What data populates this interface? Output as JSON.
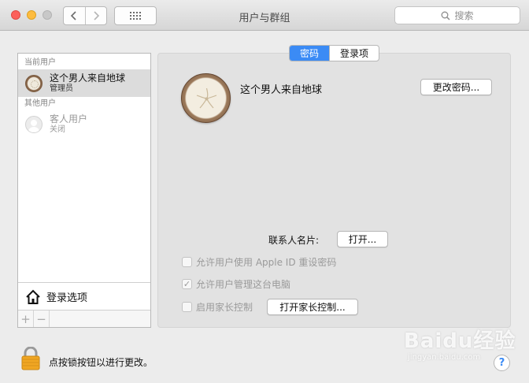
{
  "window": {
    "title": "用户与群组",
    "search_placeholder": "搜索"
  },
  "sidebar": {
    "current_users_header": "当前用户",
    "current_user": {
      "name": "这个男人来自地球",
      "role": "管理员"
    },
    "other_users_header": "其他用户",
    "guest_user": {
      "name": "客人用户",
      "status": "关闭"
    },
    "login_options_label": "登录选项",
    "add_label": "+",
    "remove_label": "−"
  },
  "tabs": [
    {
      "label": "密码",
      "active": true
    },
    {
      "label": "登录项",
      "active": false
    }
  ],
  "detail": {
    "username": "这个男人来自地球",
    "change_password_label": "更改密码...",
    "contact_card_label": "联系人名片:",
    "open_label": "打开...",
    "checkbox_appleid": {
      "label": "允许用户使用 Apple ID 重设密码",
      "checked": false
    },
    "checkbox_admin": {
      "label": "允许用户管理这台电脑",
      "checked": true
    },
    "checkbox_parental": {
      "label": "启用家长控制",
      "checked": false
    },
    "open_parental_label": "打开家长控制..."
  },
  "footer": {
    "lock_text": "点按锁按钮以进行更改。",
    "help_label": "?"
  },
  "watermark": {
    "main": "Baidu经验",
    "sub": "jingyan.baidu.com"
  },
  "colors": {
    "accent": "#3b8bf5",
    "close": "#fc605b",
    "minimize": "#fdbc40",
    "lock": "#f0a623"
  }
}
